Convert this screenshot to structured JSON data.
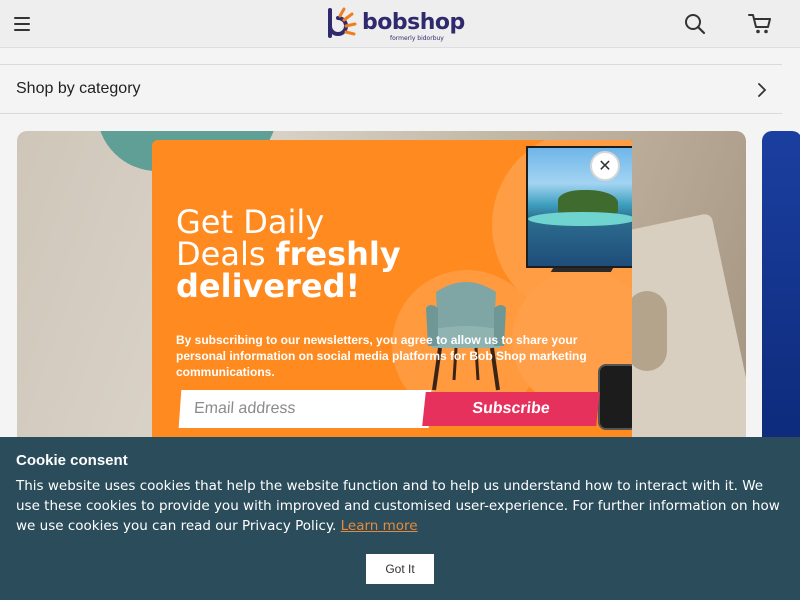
{
  "header": {
    "logo_text": "bobshop",
    "logo_subtext": "formerly bidorbuy",
    "icons": [
      "hamburger-menu-icon",
      "search-icon",
      "cart-icon"
    ]
  },
  "category_bar": {
    "label": "Shop by category"
  },
  "popup": {
    "heading_light": "Get Daily",
    "heading_mixed_light": "Deals",
    "heading_mixed_bold": "freshly",
    "heading_bold": "delivered!",
    "body": "By subscribing to our newsletters, you agree to allow us to share your personal information on social media platforms for Bob Shop marketing communications.",
    "email_placeholder": "Email address",
    "subscribe_label": "Subscribe",
    "close_label": "✕",
    "colors": {
      "background": "#ff8a1f",
      "subscribe": "#e6315c"
    }
  },
  "cookie": {
    "title": "Cookie consent",
    "text": "This website uses cookies that help the website function and to help us understand how to interact with it. We use these cookies to provide you with improved and customised user-experience. For further information on how we use cookies you can read our Privacy Policy.",
    "link": "Learn more",
    "button": "Got It",
    "colors": {
      "background": "#2b4c5b",
      "link": "#e58a3c"
    }
  }
}
